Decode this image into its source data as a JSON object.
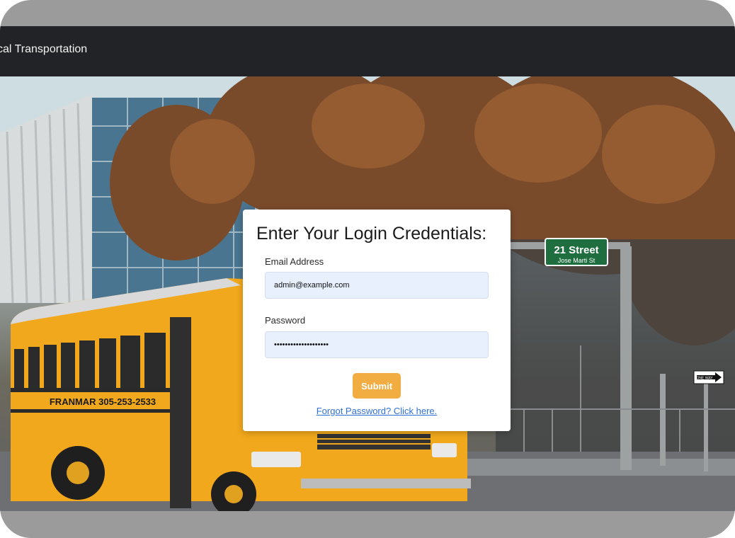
{
  "navbar": {
    "brand": "tical Transportation"
  },
  "login": {
    "title": "Enter Your Login Credentials:",
    "email_label": "Email Address",
    "email_value": "admin@example.com",
    "password_label": "Password",
    "password_value": "••••••••••••••••••••",
    "submit_label": "Submit",
    "forgot_link": "Forgot Password? Click here."
  },
  "background": {
    "bus_lettering": "FRANMAR 305-253-2533",
    "street_sign_line1": "21 Street",
    "street_sign_line2": "Jose Marti St",
    "one_way_sign": "ONE WAY"
  },
  "colors": {
    "navbar_bg": "#222326",
    "submit_bg": "#f2ad42",
    "link": "#2f6fd6",
    "input_bg": "#e8f0fe"
  }
}
